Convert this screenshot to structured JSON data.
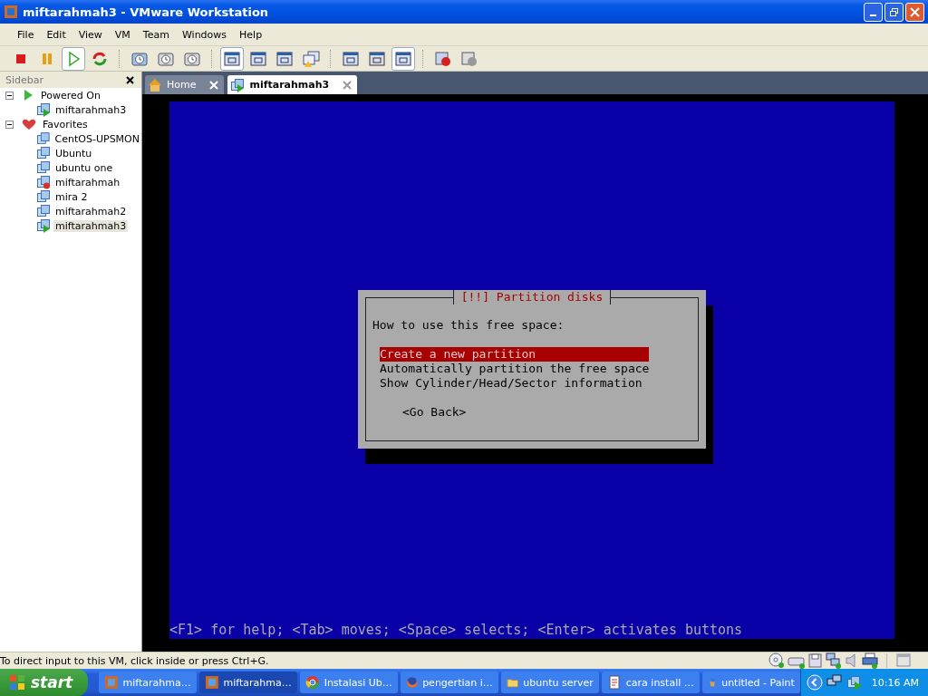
{
  "window": {
    "title": "miftarahmah3 - VMware Workstation"
  },
  "menu": [
    {
      "label": "File"
    },
    {
      "label": "Edit"
    },
    {
      "label": "View"
    },
    {
      "label": "VM"
    },
    {
      "label": "Team"
    },
    {
      "label": "Windows"
    },
    {
      "label": "Help"
    }
  ],
  "sidebar": {
    "title": "Sidebar",
    "tree": [
      {
        "label": "Powered On",
        "kind": "powered",
        "expanded": true,
        "selected": false,
        "children": [
          {
            "label": "miftarahmah3",
            "kind": "vm-running",
            "selected": false
          }
        ]
      },
      {
        "label": "Favorites",
        "kind": "favorites",
        "expanded": true,
        "selected": false,
        "children": [
          {
            "label": "CentOS-UPSMON",
            "kind": "vm",
            "selected": false
          },
          {
            "label": "Ubuntu",
            "kind": "vm",
            "selected": false
          },
          {
            "label": "ubuntu one",
            "kind": "vm",
            "selected": false
          },
          {
            "label": "miftarahmah",
            "kind": "vm-error",
            "selected": false
          },
          {
            "label": "mira 2",
            "kind": "vm",
            "selected": false
          },
          {
            "label": "miftarahmah2",
            "kind": "vm",
            "selected": false
          },
          {
            "label": "miftarahmah3",
            "kind": "vm-running",
            "selected": true
          }
        ]
      }
    ]
  },
  "tabs": [
    {
      "label": "Home",
      "kind": "home",
      "selected": false
    },
    {
      "label": "miftarahmah3",
      "kind": "vm",
      "selected": true
    }
  ],
  "console": {
    "dialog": {
      "title": "[!!] Partition disks",
      "prompt": "How to use this free space:",
      "options": [
        {
          "label": "Create a new partition",
          "selected": true
        },
        {
          "label": "Automatically partition the free space",
          "selected": false
        },
        {
          "label": "Show Cylinder/Head/Sector information",
          "selected": false
        }
      ],
      "button": "<Go Back>"
    },
    "help": "<F1> for help; <Tab> moves; <Space> selects; <Enter> activates buttons"
  },
  "status_bar": {
    "message": "To direct input to this VM, click inside or press Ctrl+G."
  },
  "taskbar": {
    "start": "start",
    "tasks": [
      {
        "label": "miftarahma…",
        "kind": "vmware",
        "selected": false
      },
      {
        "label": "miftarahma…",
        "kind": "vmware",
        "selected": true
      },
      {
        "label": "Instalasi Ub…",
        "kind": "browser",
        "selected": false
      },
      {
        "label": "pengertian i…",
        "kind": "firefox",
        "selected": false
      },
      {
        "label": "ubuntu server",
        "kind": "folder",
        "selected": false
      },
      {
        "label": "cara install …",
        "kind": "document",
        "selected": false
      },
      {
        "label": "untitled - Paint",
        "kind": "paint",
        "selected": false
      }
    ],
    "clock": "10:16 AM"
  }
}
